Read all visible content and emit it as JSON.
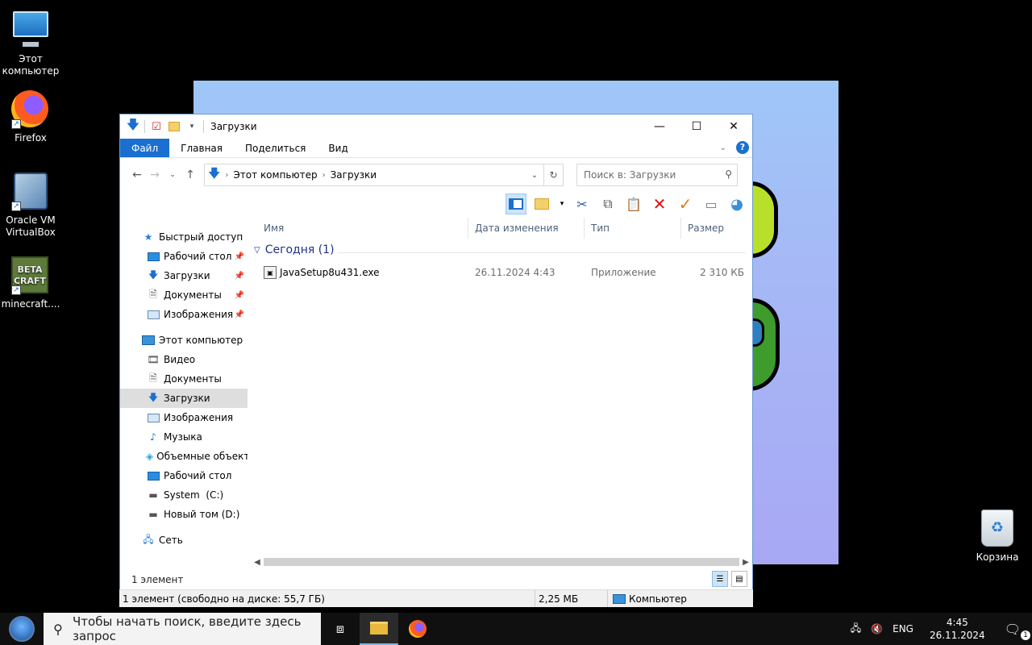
{
  "desktop": {
    "icons": [
      {
        "label": "Этот компьютер"
      },
      {
        "label": "Firefox"
      },
      {
        "label": "Oracle VM VirtualBox"
      },
      {
        "label": "minecraft...."
      },
      {
        "label": "Корзина"
      }
    ],
    "minecraft_logo": "BETA CRAFT"
  },
  "explorer": {
    "title": "Загрузки",
    "tabs": {
      "file": "Файл",
      "home": "Главная",
      "share": "Поделиться",
      "view": "Вид"
    },
    "help": "?",
    "breadcrumb": [
      "Этот компьютер",
      "Загрузки"
    ],
    "search_placeholder": "Поиск в: Загрузки",
    "columns": {
      "name": "Имя",
      "date": "Дата изменения",
      "type": "Тип",
      "size": "Размер"
    },
    "group": "Сегодня (1)",
    "file": {
      "name": "JavaSetup8u431.exe",
      "date": "26.11.2024 4:43",
      "type": "Приложение",
      "size": "2 310 КБ"
    },
    "nav": {
      "quick_access": "Быстрый доступ",
      "qa_items": [
        "Рабочий стол",
        "Загрузки",
        "Документы",
        "Изображения"
      ],
      "this_pc": "Этот компьютер",
      "pc_items": [
        "Видео",
        "Документы",
        "Загрузки",
        "Изображения",
        "Музыка",
        "Объемные объекты",
        "Рабочий стол",
        "System  (C:)",
        "Новый том (D:)"
      ],
      "network": "Сеть"
    },
    "item_count": "1 элемент",
    "status": {
      "left": "1 элемент (свободно на диске: 55,7 ГБ)",
      "size": "2,25 МБ",
      "location": "Компьютер"
    }
  },
  "taskbar": {
    "search_placeholder": "Чтобы начать поиск, введите здесь запрос",
    "lang": "ENG",
    "time": "4:45",
    "date": "26.11.2024",
    "notifications": "1"
  },
  "colors": {
    "accent": "#1a6fd0",
    "group_text": "#1e3287",
    "selected_nav": "#dedede"
  }
}
